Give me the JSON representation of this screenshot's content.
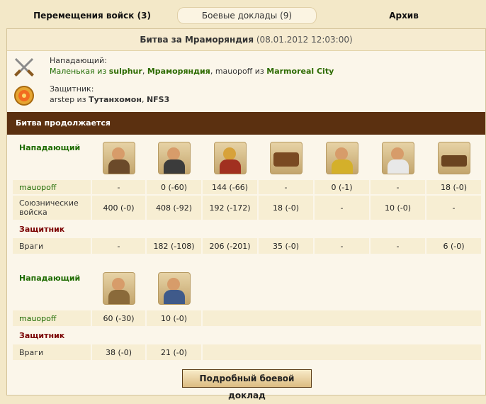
{
  "tabs": [
    "Перемещения войск (3)",
    "Боевые доклады (9)",
    "Архив"
  ],
  "battle": {
    "title": "Битва за Мраморяндия",
    "datetime": "(08.01.2012 12:03:00)"
  },
  "attacker": {
    "label": "Нападающий:",
    "unit": "Маленькая из",
    "player1": "sulphur",
    "city1": "Мраморяндия",
    "who": "mauopoff из",
    "city2": "Marmoreal City"
  },
  "defender": {
    "label": "Защитник:",
    "who": "arstep из",
    "city": "Тутанхомон",
    "alliance": "NFS3"
  },
  "status": "Битва продолжается",
  "table1": {
    "attacker_label": "Нападающий",
    "defender_label": "Защитник",
    "rows_att": [
      {
        "name": "mauopoff",
        "vals": [
          "-",
          "0 (-60)",
          "144 (-66)",
          "-",
          "0 (-1)",
          "-",
          "18 (-0)"
        ]
      },
      {
        "name": "Союзнические войска",
        "vals": [
          "400 (-0)",
          "408 (-92)",
          "192 (-172)",
          "18 (-0)",
          "-",
          "10 (-0)",
          "-"
        ]
      }
    ],
    "rows_def": [
      {
        "name": "Враги",
        "vals": [
          "-",
          "182 (-108)",
          "206 (-201)",
          "35 (-0)",
          "-",
          "-",
          "6 (-0)"
        ]
      }
    ],
    "unit_icons": [
      "slinger-icon",
      "swordsman-icon",
      "hoplite-icon",
      "battering-ram-icon",
      "gunner-icon",
      "doctor-icon",
      "catapult-icon"
    ]
  },
  "table2": {
    "attacker_label": "Нападающий",
    "defender_label": "Защитник",
    "rows_att": [
      {
        "name": "mauopoff",
        "vals": [
          "60 (-30)",
          "10 (-0)"
        ]
      }
    ],
    "rows_def": [
      {
        "name": "Враги",
        "vals": [
          "38 (-0)",
          "21 (-0)"
        ]
      }
    ],
    "unit_icons": [
      "archer-icon",
      "spearman-icon"
    ]
  },
  "button_label": "Подробный боевой доклад"
}
